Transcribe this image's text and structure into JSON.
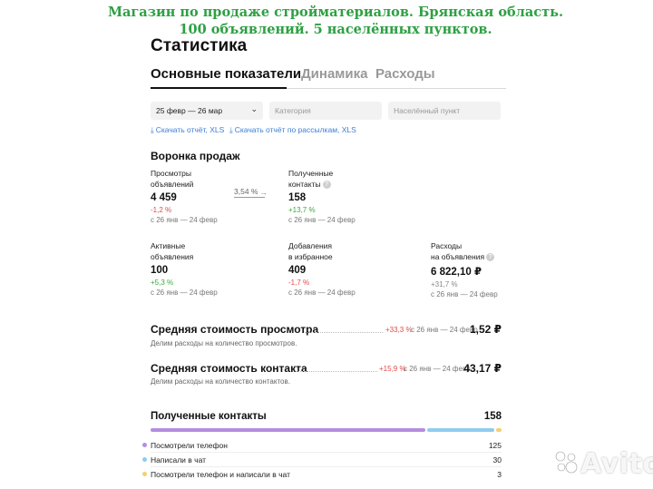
{
  "banner": {
    "line1": "Магазин по продаже стройматериалов. Брянская область.",
    "line2": "100 объявлений. 5 населённых пунктов."
  },
  "page_title": "Статистика",
  "tabs": [
    {
      "label": "Основные показатели",
      "active": true
    },
    {
      "label": "Динамика",
      "active": false
    },
    {
      "label": "Расходы",
      "active": false
    }
  ],
  "filters": {
    "period": "25 февр — 26 мар",
    "category_placeholder": "Категория",
    "city_placeholder": "Населённый пункт"
  },
  "downloads": {
    "report": "Скачать отчёт, XLS",
    "mailing_report": "Скачать отчёт по рассылкам, XLS"
  },
  "funnel": {
    "title": "Воронка продаж",
    "conversion": "3,54 %",
    "metrics": [
      {
        "label1": "Просмотры",
        "label2": "объявлений",
        "value": "4 459",
        "delta": "-1,2 %",
        "delta_dir": "down",
        "period": "с 26 янв — 24 февр"
      },
      {
        "label1": "Полученные",
        "label2": "контакты",
        "value": "158",
        "delta": "+13,7 %",
        "delta_dir": "up",
        "period": "с 26 янв — 24 февр"
      },
      {
        "label1": "Активные",
        "label2": "объявления",
        "value": "100",
        "delta": "+5,3 %",
        "delta_dir": "up",
        "period": "с 26 янв — 24 февр"
      },
      {
        "label1": "Добавления",
        "label2": "в избранное",
        "value": "409",
        "delta": "-1,7 %",
        "delta_dir": "down",
        "period": "с 26 янв — 24 февр"
      },
      {
        "label1": "Расходы",
        "label2": "на объявления",
        "value": "6 822,10 ₽",
        "delta": "+31,7 %",
        "delta_dir": "neutral",
        "period": "с 26 янв — 24 февр"
      }
    ]
  },
  "avg_view_cost": {
    "title": "Средняя стоимость просмотра",
    "subtitle": "Делим расходы на количество просмотров.",
    "delta": "+33,3 %",
    "period": "с 26 янв — 24 февр",
    "value": "1,52 ₽"
  },
  "avg_contact_cost": {
    "title": "Средняя стоимость контакта",
    "subtitle": "Делим расходы на количество контактов.",
    "delta": "+15,9 %",
    "period": "с 26 янв — 24 февр",
    "value": "43,17 ₽"
  },
  "contacts": {
    "title": "Полученные контакты",
    "total": "158",
    "items": [
      {
        "label": "Посмотрели телефон",
        "value": "125",
        "color": "#b48ee0"
      },
      {
        "label": "Написали в чат",
        "value": "30",
        "color": "#8fcdf0"
      },
      {
        "label": "Посмотрели телефон и написали в чат",
        "value": "3",
        "color": "#f5cf72"
      }
    ]
  },
  "watermark": "Avito",
  "colors": {
    "banner": "#2ea043",
    "link": "#3b7fd6",
    "delta_down": "#e04a4a",
    "delta_up": "#3aab3a"
  }
}
